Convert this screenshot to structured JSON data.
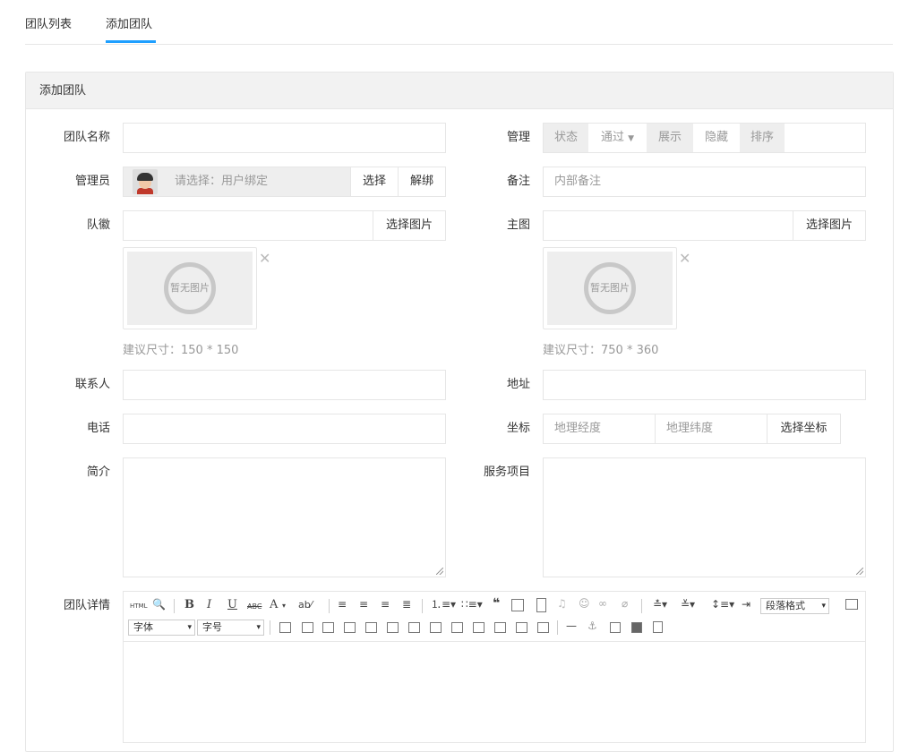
{
  "tabs": [
    {
      "label": "团队列表"
    },
    {
      "label": "添加团队"
    }
  ],
  "panel": {
    "title": "添加团队"
  },
  "form": {
    "name": {
      "label": "团队名称",
      "value": ""
    },
    "manage": {
      "label": "管理",
      "status": "状态",
      "pass": "通过",
      "show": "展示",
      "hide": "隐藏",
      "sort": "排序"
    },
    "admin": {
      "label": "管理员",
      "placeholder": "请选择：用户绑定",
      "select": "选择",
      "unbind": "解绑"
    },
    "remark": {
      "label": "备注",
      "placeholder": "内部备注"
    },
    "badge": {
      "label": "队徽",
      "select": "选择图片",
      "hint": "建议尺寸：150 * 150",
      "noimg": "暂无图片"
    },
    "main_image": {
      "label": "主图",
      "select": "选择图片",
      "hint": "建议尺寸：750 * 360",
      "noimg": "暂无图片"
    },
    "contact": {
      "label": "联系人"
    },
    "address": {
      "label": "地址"
    },
    "phone": {
      "label": "电话"
    },
    "coord": {
      "label": "坐标",
      "lng_placeholder": "地理经度",
      "lat_placeholder": "地理纬度",
      "select": "选择坐标"
    },
    "intro": {
      "label": "简介"
    },
    "services": {
      "label": "服务项目"
    },
    "detail": {
      "label": "团队详情"
    }
  },
  "editor": {
    "html": "HTML",
    "bold": "B",
    "italic": "I",
    "underline": "U",
    "strike": "ABC",
    "fontcolor": "A",
    "paragraph": "段落格式",
    "font_family": "字体",
    "font_size": "字号"
  },
  "colors": {
    "accent": "#1e9fff",
    "border": "#e6e6e6",
    "muted": "#999999"
  }
}
